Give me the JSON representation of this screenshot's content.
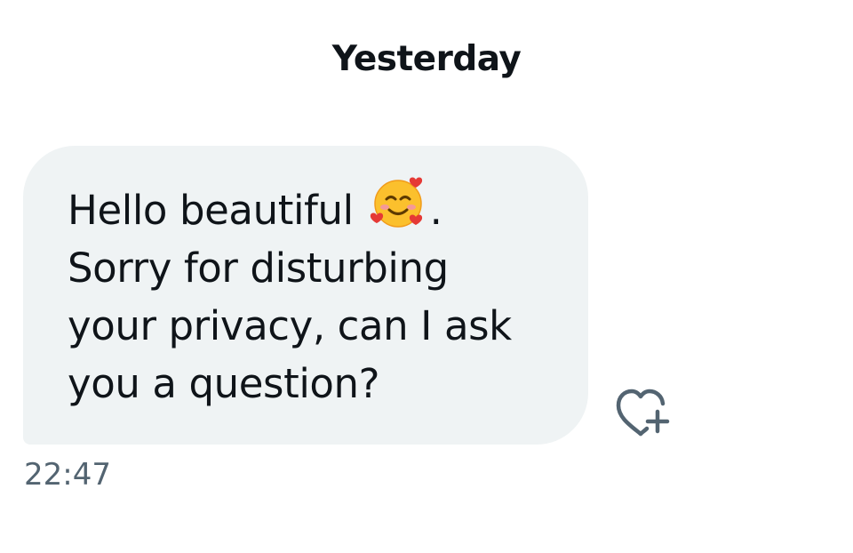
{
  "conversation": {
    "date_separator": "Yesterday"
  },
  "message": {
    "lines": [
      {
        "before": "Hello beautiful ",
        "emoji": "smiling-face-with-hearts",
        "after": "."
      },
      {
        "text": "Sorry for disturbing"
      },
      {
        "text": "your privacy, can I ask"
      },
      {
        "text": "you a question?"
      }
    ],
    "timestamp": "22:47",
    "bubble_color": "#eff3f4",
    "text_color": "#0f1419",
    "timestamp_color": "#536471"
  },
  "actions": {
    "react_icon": "heart-plus-icon",
    "icon_color": "#536471"
  }
}
